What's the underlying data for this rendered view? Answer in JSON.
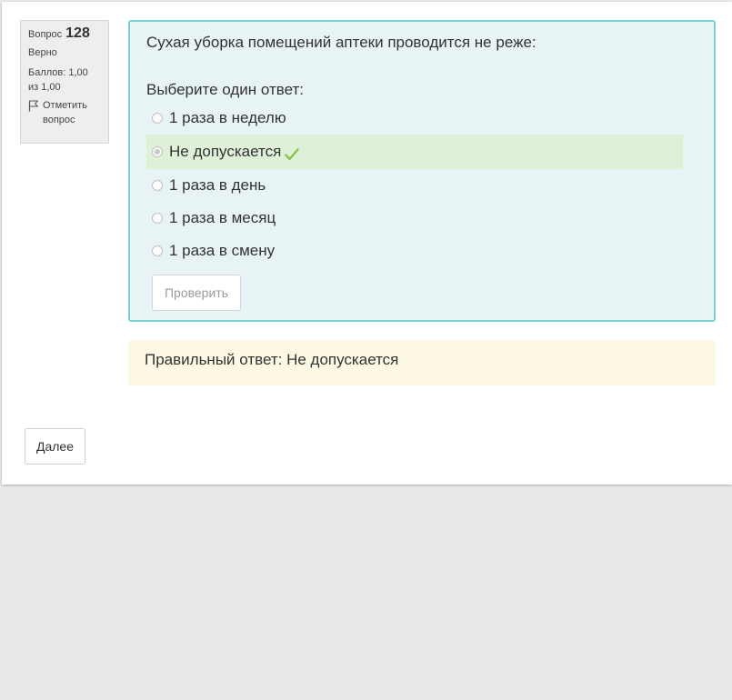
{
  "info": {
    "question_label": "Вопрос",
    "question_number": "128",
    "state": "Верно",
    "grade": "Баллов: 1,00 из 1,00",
    "flag_label": "Отметить вопрос"
  },
  "question": {
    "text": "Сухая уборка помещений аптеки проводится не реже:",
    "prompt": "Выберите один ответ:",
    "options": [
      {
        "label": "1 раза в неделю",
        "selected": false,
        "correct": false
      },
      {
        "label": "Не допускается",
        "selected": true,
        "correct": true
      },
      {
        "label": "1 раза в день",
        "selected": false,
        "correct": false
      },
      {
        "label": "1 раза в месяц",
        "selected": false,
        "correct": false
      },
      {
        "label": "1 раза в смену",
        "selected": false,
        "correct": false
      }
    ],
    "check_button": "Проверить"
  },
  "feedback": {
    "right_answer": "Правильный ответ: Не допускается"
  },
  "navigation": {
    "next_button": "Далее"
  },
  "colors": {
    "formulation_bg": "#e7f3f5",
    "formulation_border": "#7fcfd8",
    "correct_bg": "#dff0d8",
    "feedback_bg": "#fcf8e3",
    "check_mark": "#8bc34a"
  },
  "icons": {
    "flag": "flag-icon",
    "correct": "check-icon"
  }
}
